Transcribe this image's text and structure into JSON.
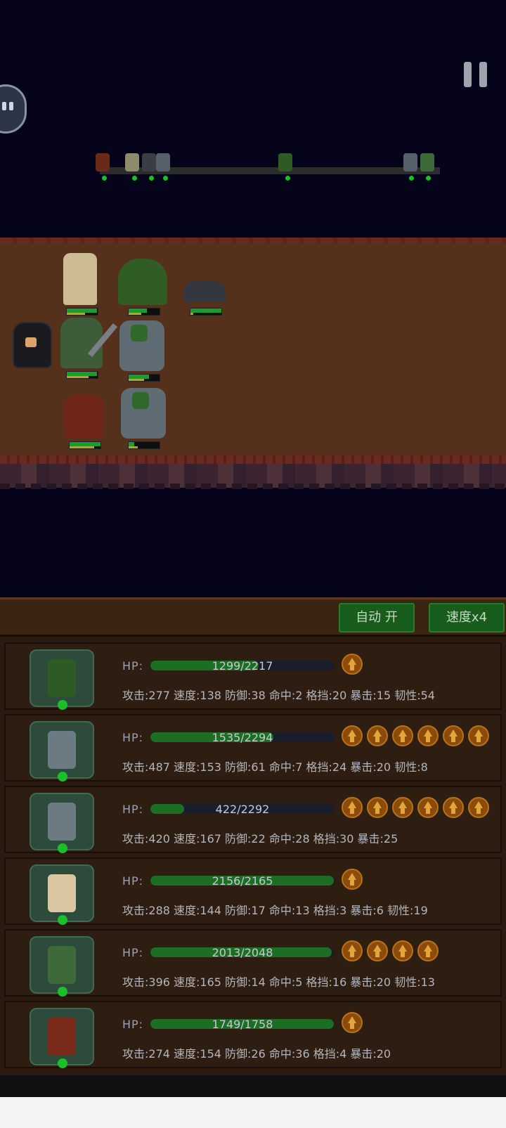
{
  "battle": {
    "pause_icon": "pause-icon",
    "chat_icon": "chat-bubble-icon",
    "timeline_markers": 8,
    "auto_label": "自动 开",
    "speed_label": "速度x4"
  },
  "colors": {
    "hp": "#1e9b2c",
    "mana": "#c3a01c",
    "button": "#175c1a",
    "marker": "#1bbf2a"
  },
  "units": [
    {
      "name": "treant",
      "hp": "1299/2217",
      "stats": "攻击:277 速度:138 防御:38 命中:2 格挡:20 暴击:15 韧性:54",
      "upgrades": 1,
      "hp_ratio": 0.586,
      "sprite_color": "#2e5a23"
    },
    {
      "name": "goblin-rider-1",
      "hp": "1535/2294",
      "stats": "攻击:487 速度:153 防御:61 命中:7 格挡:24 暴击:20 韧性:8",
      "upgrades": 6,
      "hp_ratio": 0.669,
      "sprite_color": "#6c7a84"
    },
    {
      "name": "goblin-rider-2",
      "hp": "422/2292",
      "stats": "攻击:420 速度:167 防御:22 命中:28 格挡:30 暴击:25",
      "upgrades": 6,
      "hp_ratio": 0.184,
      "sprite_color": "#6c7a84"
    },
    {
      "name": "elder-mage",
      "hp": "2156/2165",
      "stats": "攻击:288 速度:144 防御:17 命中:13 格挡:3 暴击:6 韧性:19",
      "upgrades": 1,
      "hp_ratio": 0.996,
      "sprite_color": "#d8c7a2"
    },
    {
      "name": "orc-warrior",
      "hp": "2013/2048",
      "stats": "攻击:396 速度:165 防御:14 命中:5 格挡:16 暴击:20 韧性:13",
      "upgrades": 4,
      "hp_ratio": 0.983,
      "sprite_color": "#3e6a3a"
    },
    {
      "name": "minotaur",
      "hp": "1749/1758",
      "stats": "攻击:274 速度:154 防御:26 命中:36 格挡:4 暴击:20",
      "upgrades": 1,
      "hp_ratio": 0.995,
      "sprite_color": "#7a2a1a"
    }
  ]
}
